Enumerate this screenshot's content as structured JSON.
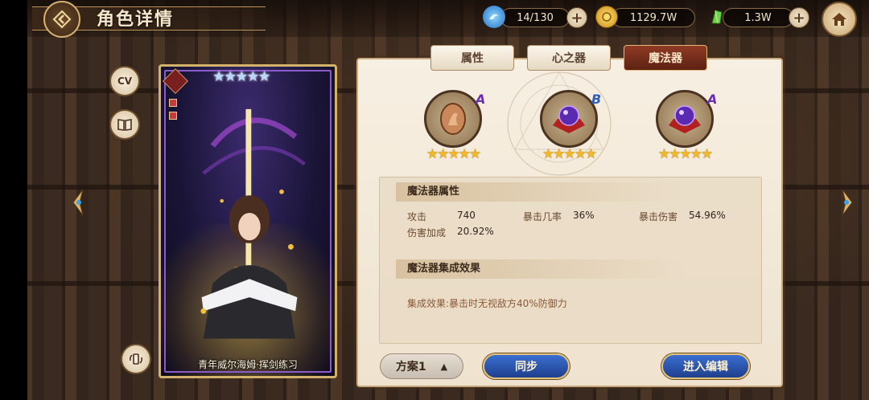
{
  "header": {
    "title": "角色详情"
  },
  "resources": [
    {
      "name": "stamina",
      "icon": "blue-swirl-icon",
      "value": "14/130",
      "color": "#3aa4e8"
    },
    {
      "name": "gold",
      "icon": "gold-coin-icon",
      "value": "1129.7W",
      "color": "#f0c030"
    },
    {
      "name": "crystal",
      "icon": "green-crystal-icon",
      "value": "1.3W",
      "color": "#5ec040"
    }
  ],
  "side": {
    "cv_label": "CV"
  },
  "card": {
    "name": "青年威尔海姆·挥剑练习",
    "stars": "★★★★★"
  },
  "tabs": [
    {
      "label": "属性",
      "active": false
    },
    {
      "label": "心之器",
      "active": false
    },
    {
      "label": "魔法器",
      "active": true
    }
  ],
  "artifacts": [
    {
      "grade": "A",
      "stars": "★★★★★",
      "grade_color": "#6a2fb0",
      "icon": "cameo-icon"
    },
    {
      "grade": "B",
      "stars": "★★★★★",
      "grade_color": "#2f5fc0",
      "icon": "purple-orb-icon"
    },
    {
      "grade": "A",
      "stars": "★★★★★",
      "grade_color": "#6a2fb0",
      "icon": "purple-orb-icon"
    }
  ],
  "attributes": {
    "section_title": "魔法器属性",
    "stats": [
      {
        "label": "攻击",
        "value": "740"
      },
      {
        "label": "暴击几率",
        "value": "36%"
      },
      {
        "label": "暴击伤害",
        "value": "54.96%"
      },
      {
        "label": "伤害加成",
        "value": "20.92%"
      }
    ]
  },
  "set_effect": {
    "section_title": "魔法器集成效果",
    "text": "集成效果:暴击时无视敌方40%防御力"
  },
  "bottom": {
    "plan_label": "方案1",
    "plan_arrow": "▲",
    "sync_label": "同步",
    "edit_label": "进入编辑"
  }
}
